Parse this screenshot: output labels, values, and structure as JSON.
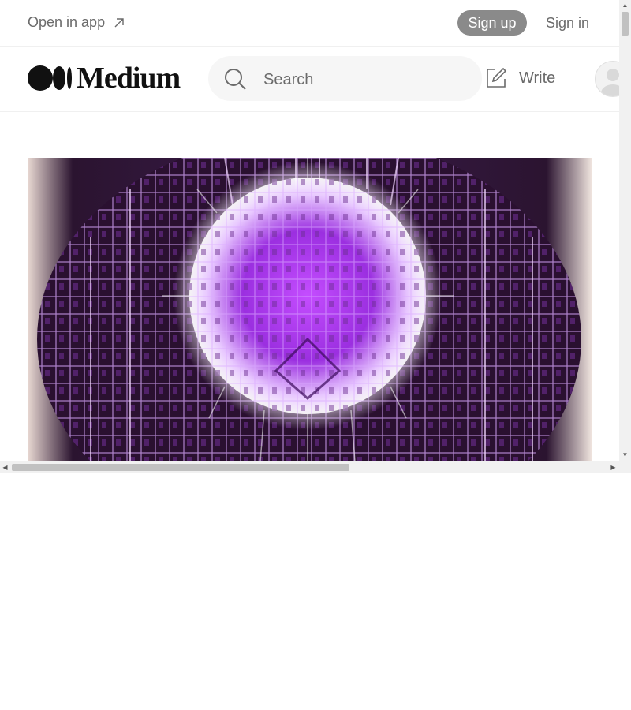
{
  "topbar": {
    "open_in_app": "Open in app",
    "sign_up": "Sign up",
    "sign_in": "Sign in"
  },
  "header": {
    "logo_text": "Medium",
    "search_placeholder": "Search",
    "write_label": "Write"
  },
  "colors": {
    "signup_bg": "#8a8a8a",
    "muted_text": "#6b6b6b",
    "search_bg": "#f6f6f6",
    "hero_accent": "#b04cff"
  },
  "icons": [
    "arrow-up-right-icon",
    "medium-logo-icon",
    "search-icon",
    "write-icon",
    "avatar-icon"
  ]
}
